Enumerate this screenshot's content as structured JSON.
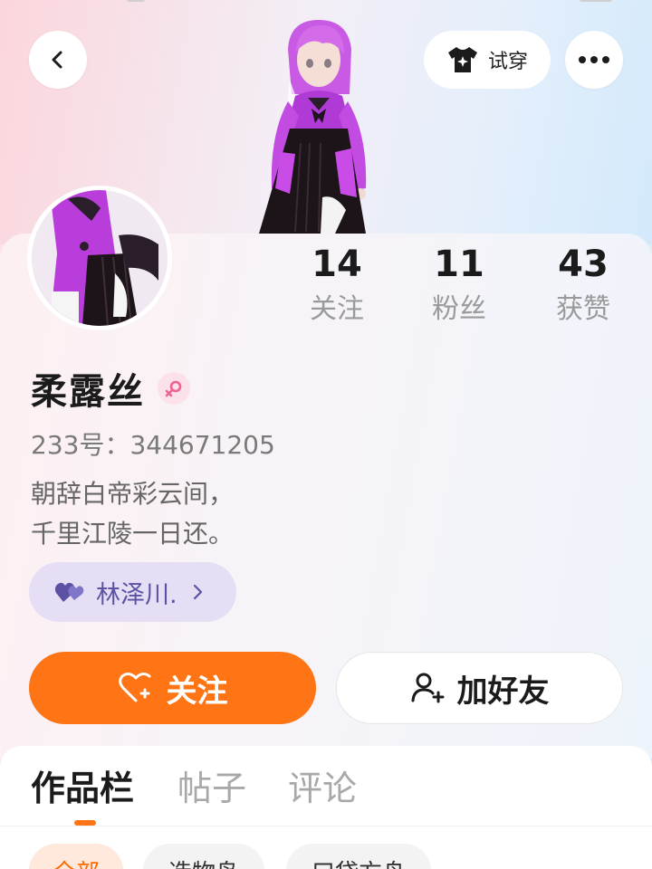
{
  "header": {
    "try_on_label": "试穿"
  },
  "profile": {
    "name": "柔露丝",
    "gender": "female",
    "uid_line": "233号：344671205",
    "bio_line1": "朝辞白帝彩云间，",
    "bio_line2": "千里江陵一日还。",
    "cp_name": "林泽川."
  },
  "stats": [
    {
      "value": "14",
      "label": "关注"
    },
    {
      "value": "11",
      "label": "粉丝"
    },
    {
      "value": "43",
      "label": "获赞"
    }
  ],
  "actions": {
    "follow_label": "关注",
    "add_friend_label": "加好友"
  },
  "tabs": [
    {
      "label": "作品栏",
      "active": true
    },
    {
      "label": "帖子",
      "active": false
    },
    {
      "label": "评论",
      "active": false
    }
  ],
  "filters": [
    {
      "label": "全部",
      "active": true
    },
    {
      "label": "造物岛",
      "active": false
    },
    {
      "label": "口袋方舟",
      "active": false
    }
  ],
  "colors": {
    "accent": "#ff7414",
    "cp_tag_bg": "#e6def5",
    "cp_tag_text": "#5b52a3",
    "gender_female": "#f06292"
  }
}
